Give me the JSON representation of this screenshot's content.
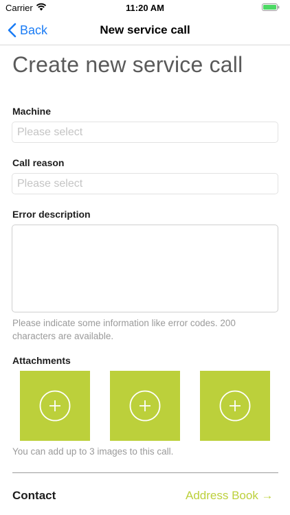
{
  "status_bar": {
    "carrier": "Carrier",
    "time": "11:20 AM"
  },
  "nav": {
    "back_label": "Back",
    "title": "New service call"
  },
  "page_title": "Create new service call",
  "fields": {
    "machine": {
      "label": "Machine",
      "placeholder": "Please select"
    },
    "call_reason": {
      "label": "Call reason",
      "placeholder": "Please select"
    },
    "error_description": {
      "label": "Error description",
      "value": "",
      "hint": "Please indicate some information like error codes. 200 characters are available."
    }
  },
  "attachments": {
    "label": "Attachments",
    "slots": [
      "plus-icon",
      "plus-icon",
      "plus-icon"
    ],
    "hint": "You can add up to 3 images to this call."
  },
  "contact": {
    "label": "Contact",
    "address_book_label": "Address Book →"
  },
  "colors": {
    "accent_green": "#bcd03b",
    "ios_blue": "#1a7cf5"
  }
}
